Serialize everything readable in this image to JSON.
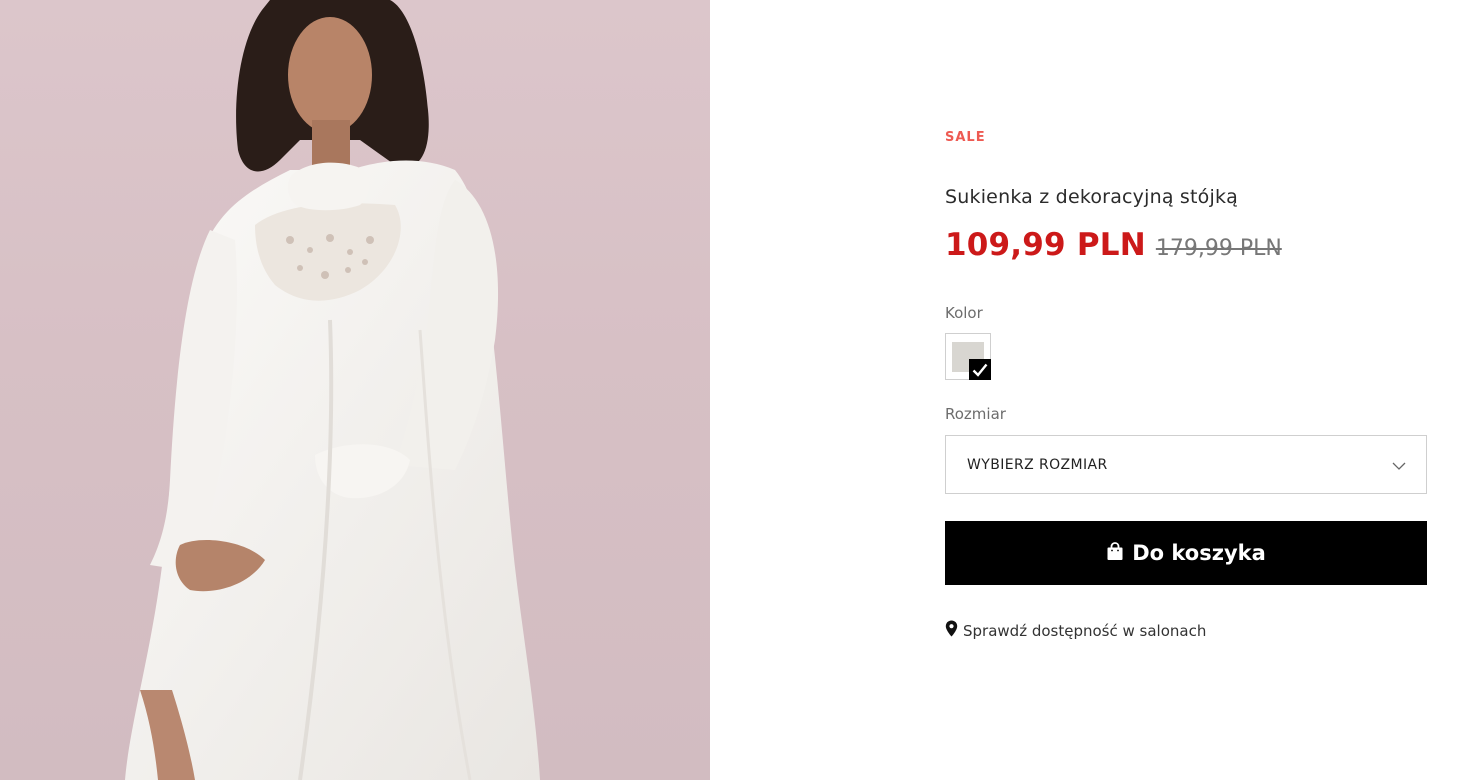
{
  "product": {
    "badge": "SALE",
    "name": "Sukienka z dekoracyjną stójką",
    "price_current": "109,99 PLN",
    "price_old": "179,99 PLN"
  },
  "color_section": {
    "label": "Kolor",
    "swatch_color": "#d8d6d1",
    "selected": true
  },
  "size_section": {
    "label": "Rozmiar",
    "select_value": "WYBIERZ ROZMIAR"
  },
  "cart": {
    "button_label": "Do koszyka",
    "icon": "shopping-bag-icon"
  },
  "store_check": {
    "icon": "map-pin-icon",
    "label": "Sprawdź dostępność w salonach"
  },
  "colors": {
    "sale_accent": "#ee5a52",
    "price_red": "#cc1919",
    "button_bg": "#000000",
    "photo_bg": "#d7c0c5"
  }
}
